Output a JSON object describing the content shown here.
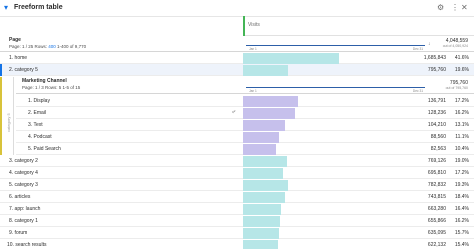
{
  "panel": {
    "title": "Freeform table",
    "chevron_icon": "chevron-down-icon",
    "icons": [
      "gear-icon",
      "more-icon",
      "close-icon"
    ]
  },
  "metric": {
    "label": "Visits",
    "accent_color": "#44b556"
  },
  "page_dimension": {
    "title": "Page",
    "pager_prefix": "Page: 1 / 25  Rows: ",
    "rows_value": "400",
    "pager_suffix": " 1-400 of 9,770",
    "spark_start": "Jan 1",
    "spark_end": "Dec 31",
    "total": "4,048,559",
    "total_sub": "out of 4,050,924"
  },
  "rows_top": [
    {
      "label": "1.  home",
      "value": "1,685,843",
      "pct": "41.6%",
      "fraction": 0.416
    },
    {
      "label": "2.  category 5",
      "value": "795,760",
      "pct": "19.6%",
      "fraction": 0.196,
      "selected": true
    }
  ],
  "breakdown": {
    "title": "Marketing Channel",
    "pager": "Page: 1 / 3  Rows: 5  1-5 of 15",
    "side_label": "category 5",
    "spark_start": "Jan 1",
    "spark_end": "Dec 31",
    "total": "795,760",
    "total_sub": "out of 795,760",
    "rows": [
      {
        "label": "1.  Display",
        "value": "136,791",
        "pct": "17.2%",
        "fraction": 0.172
      },
      {
        "label": "2.  Email",
        "value": "128,236",
        "pct": "16.2%",
        "fraction": 0.162
      },
      {
        "label": "3.  Text",
        "value": "104,210",
        "pct": "13.1%",
        "fraction": 0.131
      },
      {
        "label": "4.  Podcast",
        "value": "88,560",
        "pct": "11.1%",
        "fraction": 0.111
      },
      {
        "label": "5.  Paid Search",
        "value": "82,563",
        "pct": "10.4%",
        "fraction": 0.104
      }
    ]
  },
  "rows_bottom": [
    {
      "label": "3.  category 2",
      "value": "769,126",
      "pct": "19.0%",
      "fraction": 0.19
    },
    {
      "label": "4.  category 4",
      "value": "695,810",
      "pct": "17.2%",
      "fraction": 0.172
    },
    {
      "label": "5.  category 3",
      "value": "782,832",
      "pct": "19.3%",
      "fraction": 0.193
    },
    {
      "label": "6.  articles",
      "value": "743,815",
      "pct": "18.4%",
      "fraction": 0.184
    },
    {
      "label": "7.  app: launch",
      "value": "663,280",
      "pct": "16.4%",
      "fraction": 0.164
    },
    {
      "label": "8.  category 1",
      "value": "655,866",
      "pct": "16.2%",
      "fraction": 0.162
    },
    {
      "label": "9.  forum",
      "value": "635,095",
      "pct": "15.7%",
      "fraction": 0.157
    },
    {
      "label": "10.  search results",
      "value": "622,132",
      "pct": "15.4%",
      "fraction": 0.154
    }
  ]
}
